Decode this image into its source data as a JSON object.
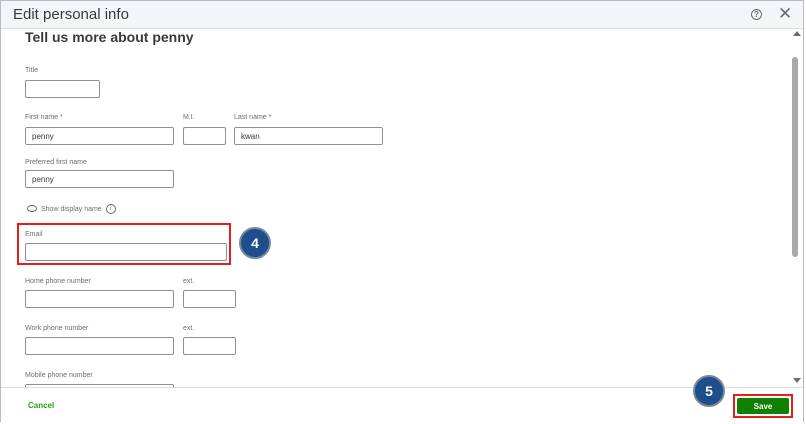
{
  "dialog": {
    "title": "Edit personal info",
    "help_glyph": "?",
    "close_glyph": "✕"
  },
  "form": {
    "heading": "Tell us more about penny",
    "title_label": "Title",
    "title_value": "",
    "first_name_label": "First name *",
    "first_name_value": "penny",
    "mi_label": "M.I.",
    "mi_value": "",
    "last_name_label": "Last name *",
    "last_name_value": "kwan",
    "preferred_label": "Preferred first name",
    "preferred_value": "penny",
    "show_display_name": "Show display name",
    "info_glyph": "i",
    "email_label": "Email",
    "email_value": "",
    "home_phone_label": "Home phone number",
    "home_ext_label": "ext.",
    "work_phone_label": "Work phone number",
    "work_ext_label": "ext.",
    "mobile_phone_label": "Mobile phone number"
  },
  "annotations": {
    "step_email": "4",
    "step_save": "5"
  },
  "footer": {
    "cancel_label": "Cancel",
    "save_label": "Save"
  },
  "colors": {
    "accent_green": "#2ca01c",
    "save_green": "#108000",
    "highlight_red": "#e0201b",
    "badge_blue": "#1f4e8c"
  },
  "icons": [
    "help-icon",
    "close-icon",
    "eye-icon",
    "info-icon",
    "scroll-up-icon",
    "scroll-down-icon"
  ]
}
